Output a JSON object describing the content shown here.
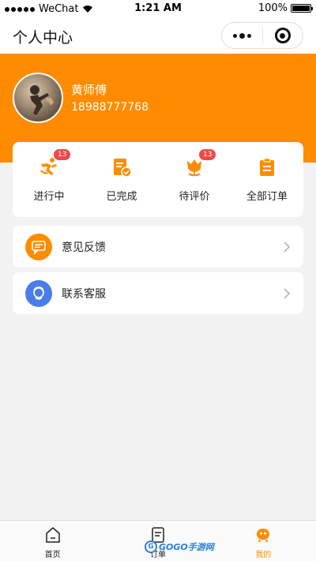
{
  "status_bar": {
    "carrier": "WeChat",
    "time": "1:21 AM",
    "battery": "100%",
    "battery_level": 1.0
  },
  "header": {
    "title": "个人中心"
  },
  "user": {
    "name": "黄师傅",
    "phone": "18988777768"
  },
  "orders": [
    {
      "label": "进行中",
      "badge": "13",
      "icon": "running-person-icon"
    },
    {
      "label": "已完成",
      "badge": "",
      "icon": "completed-doc-icon"
    },
    {
      "label": "待评价",
      "badge": "13",
      "icon": "flower-icon"
    },
    {
      "label": "全部订单",
      "badge": "",
      "icon": "clipboard-icon"
    }
  ],
  "menu": [
    {
      "label": "意见反馈",
      "icon": "feedback-chat-icon",
      "color": "#ff8c00"
    },
    {
      "label": "联系客服",
      "icon": "customer-service-icon",
      "color": "#4a7de8"
    }
  ],
  "tabs": [
    {
      "label": "首页",
      "icon": "home-icon",
      "active": false
    },
    {
      "label": "订单",
      "icon": "order-doc-icon",
      "active": false
    },
    {
      "label": "我的",
      "icon": "me-icon",
      "active": true
    }
  ],
  "watermark": {
    "text": "GOGO手游网"
  },
  "colors": {
    "accent": "#ff8c00",
    "badge": "#f04848",
    "service": "#4a7de8"
  }
}
